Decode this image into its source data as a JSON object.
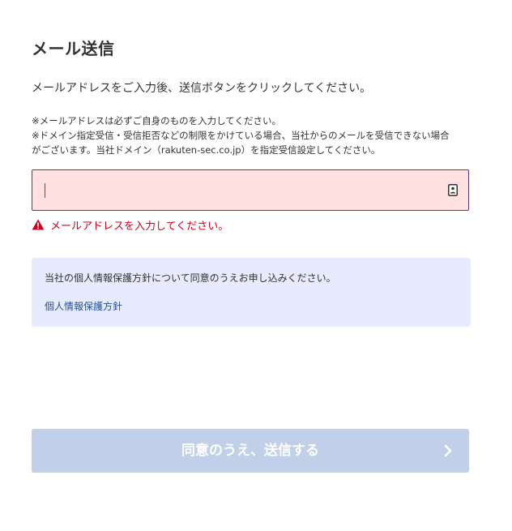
{
  "page": {
    "title": "メール送信",
    "instruction": "メールアドレスをご入力後、送信ボタンをクリックしてください。",
    "notes": [
      "※メールアドレスは必ずご自身のものを入力してください。",
      "※ドメイン指定受信・受信拒否などの制限をかけている場合、当社からのメールを受信できない場合",
      "がございます。当社ドメイン（rakuten-sec.co.jp）を指定受信設定してください。"
    ]
  },
  "email_field": {
    "value": "",
    "placeholder": "",
    "state": "error",
    "icon": "contact-card-icon"
  },
  "error": {
    "icon": "warning-icon",
    "message": "メールアドレスを入力してください。"
  },
  "privacy": {
    "text": "当社の個人情報保護方針について同意のうえお申し込みください。",
    "link_label": "個人情報保護方針"
  },
  "submit": {
    "label": "同意のうえ、送信する",
    "icon": "chevron-right-icon",
    "enabled": false
  },
  "colors": {
    "error_red": "#d0011b",
    "field_error_bg": "#ffe1e1",
    "field_border": "#5a3a8a",
    "info_box_bg": "#e6ecfd",
    "link_blue": "#1f4fa0",
    "disabled_button_bg": "#c1cfe9"
  }
}
